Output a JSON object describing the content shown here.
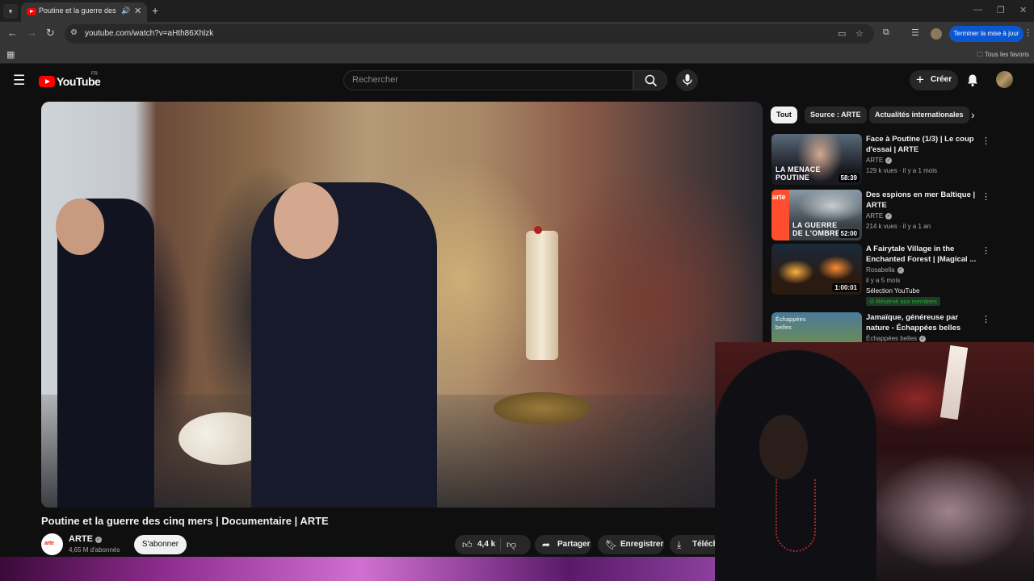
{
  "browser": {
    "tab_title": "Poutine et la guerre des cinq mers | Documentaire | ARTE",
    "url": "youtube.com/watch?v=aHth86Xhlzk",
    "update_label": "Terminer la mise à jour",
    "bookmarks_label": "Tous les favoris"
  },
  "yt": {
    "logo_text": "YouTube",
    "country": "FR",
    "search_placeholder": "Rechercher",
    "create_label": "Créer"
  },
  "video": {
    "title": "Poutine et la guerre des cinq mers | Documentaire | ARTE",
    "channel": "ARTE",
    "channel_logo": "arte",
    "subscribers": "4,65 M d'abonnés",
    "subscribe_label": "S'abonner",
    "likes": "4,4 k",
    "share_label": "Partager",
    "save_label": "Enregistrer",
    "download_label": "Télécharger"
  },
  "chips": [
    "Tout",
    "Source : ARTE",
    "Actualités internationales"
  ],
  "recommendations": [
    {
      "title": "Face à Poutine (1/3) | Le coup d'essai | ARTE",
      "channel": "ARTE",
      "meta": "129 k vues · il y a 1 mois",
      "duration": "58:39",
      "thumb_text": "LA MENACE POUTINE"
    },
    {
      "title": "Des espions en mer Baltique | ARTE",
      "channel": "ARTE",
      "meta": "214 k vues · il y a 1 an",
      "duration": "52:00",
      "thumb_text": "LA GUERRE DE L'OMBRE",
      "badge": "arte"
    },
    {
      "title": "A Fairytale Village in the Enchanted Forest | |Magical ...",
      "channel": "Rosabella",
      "meta": "il y a 5 mois",
      "duration": "1:00:01",
      "tag": "Sélection YouTube",
      "members": "Réservé aux membres"
    },
    {
      "title": "Jamaïque, généreuse par nature - Échappées belles",
      "channel": "Échappées belles",
      "thumb_text": "Échappées belles"
    }
  ],
  "colors": {
    "yt_red": "#ff0000",
    "chrome_blue": "#0b57d0",
    "members_green": "#2ba640"
  }
}
